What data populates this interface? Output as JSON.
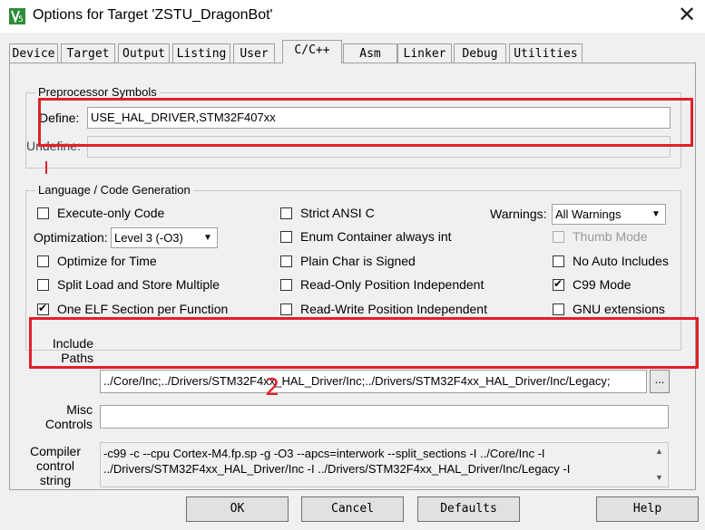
{
  "window": {
    "title": "Options for Target 'ZSTU_DragonBot'",
    "close_glyph": "✕"
  },
  "tabs": [
    "Device",
    "Target",
    "Output",
    "Listing",
    "User",
    "C/C++",
    "Asm",
    "Linker",
    "Debug",
    "Utilities"
  ],
  "active_tab": "C/C++",
  "preprocessor": {
    "group_label": "Preprocessor Symbols",
    "define_label": "Define:",
    "define_value": "USE_HAL_DRIVER,STM32F407xx",
    "undefine_label": "Undefine:",
    "undefine_value": ""
  },
  "language": {
    "group_label": "Language / Code Generation",
    "execute_only": {
      "label": "Execute-only Code",
      "checked": false
    },
    "optimization_label": "Optimization:",
    "optimization_value": "Level 3 (-O3)",
    "optimize_time": {
      "label": "Optimize for Time",
      "checked": false
    },
    "split_load": {
      "label": "Split Load and Store Multiple",
      "checked": false
    },
    "one_elf": {
      "label": "One ELF Section per Function",
      "checked": true
    },
    "strict_ansi": {
      "label": "Strict ANSI C",
      "checked": false
    },
    "enum_container": {
      "label": "Enum Container always int",
      "checked": false
    },
    "plain_char": {
      "label": "Plain Char is Signed",
      "checked": false
    },
    "ro_pi": {
      "label": "Read-Only Position Independent",
      "checked": false
    },
    "rw_pi": {
      "label": "Read-Write Position Independent",
      "checked": false
    },
    "warnings_label": "Warnings:",
    "warnings_value": "All Warnings",
    "thumb_mode": {
      "label": "Thumb Mode",
      "checked": false,
      "disabled": true
    },
    "no_auto_includes": {
      "label": "No Auto Includes",
      "checked": false
    },
    "c99_mode": {
      "label": "C99 Mode",
      "checked": true
    },
    "gnu_extensions": {
      "label": "GNU extensions",
      "checked": false
    }
  },
  "include": {
    "label_line1": "Include",
    "label_line2": "Paths",
    "value": "../Core/Inc;../Drivers/STM32F4xx_HAL_Driver/Inc;../Drivers/STM32F4xx_HAL_Driver/Inc/Legacy;",
    "browse_label": "..."
  },
  "misc": {
    "label_line1": "Misc",
    "label_line2": "Controls",
    "value": ""
  },
  "compiler": {
    "label_line1": "Compiler",
    "label_line2": "control",
    "label_line3": "string",
    "line1": "-c99 -c --cpu Cortex-M4.fp.sp -g -O3 --apcs=interwork --split_sections -I ../Core/Inc -I",
    "line2": "../Drivers/STM32F4xx_HAL_Driver/Inc -I ../Drivers/STM32F4xx_HAL_Driver/Inc/Legacy -I"
  },
  "buttons": {
    "ok": "OK",
    "cancel": "Cancel",
    "defaults": "Defaults",
    "help": "Help"
  },
  "annotations": {
    "mark_2": "2"
  },
  "colors": {
    "annotation_red": "#e0202a",
    "dialog_bg": "#f0f0f0"
  }
}
